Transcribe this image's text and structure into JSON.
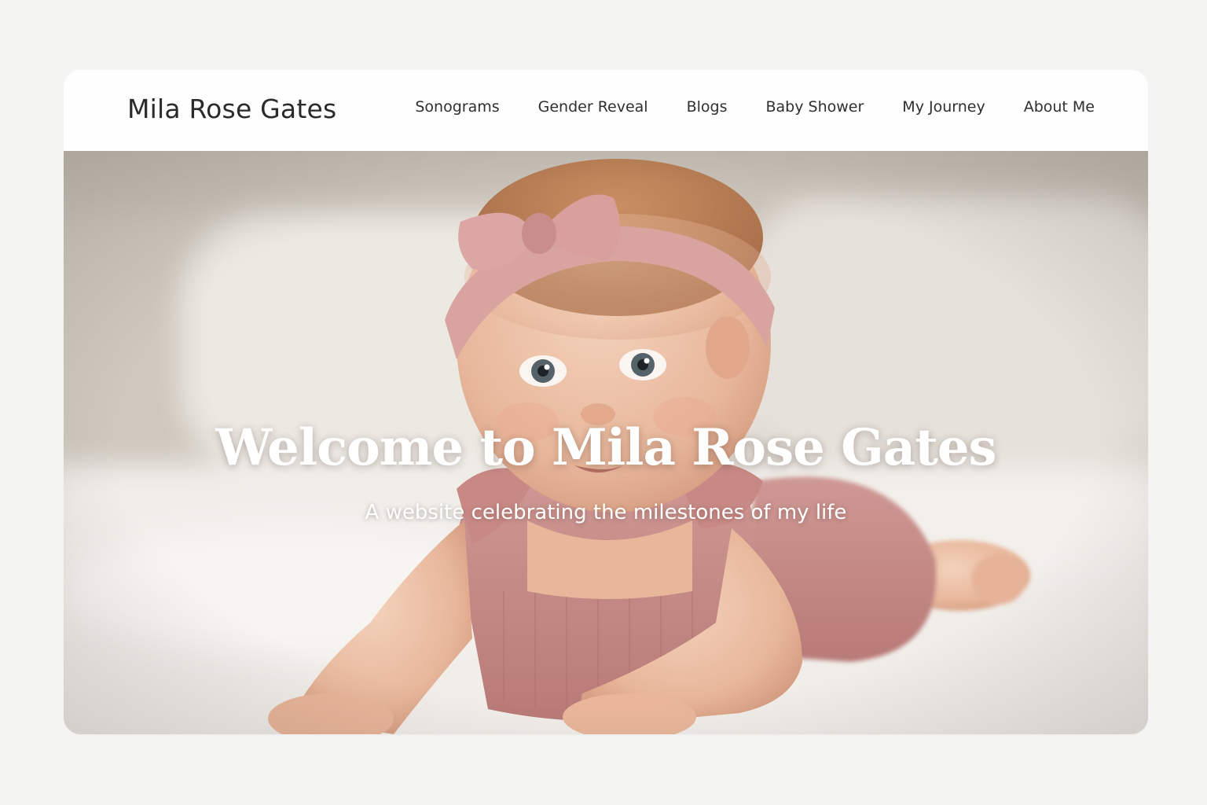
{
  "site": {
    "brand": "Mila Rose Gates"
  },
  "nav": {
    "items": [
      {
        "label": "Sonograms"
      },
      {
        "label": "Gender Reveal"
      },
      {
        "label": "Blogs"
      },
      {
        "label": "Baby Shower"
      },
      {
        "label": "My Journey"
      },
      {
        "label": "About Me"
      }
    ]
  },
  "hero": {
    "title": "Welcome to Mila Rose Gates",
    "subtitle": "A website celebrating the milestones of my life",
    "image": "baby-on-bed-photo"
  },
  "colors": {
    "page_background": "#f4f4f3",
    "header_background": "#fefefe",
    "text_dark": "#2a2a2a",
    "hero_text": "#ffffff",
    "pink_accent": "#c98e8c"
  }
}
